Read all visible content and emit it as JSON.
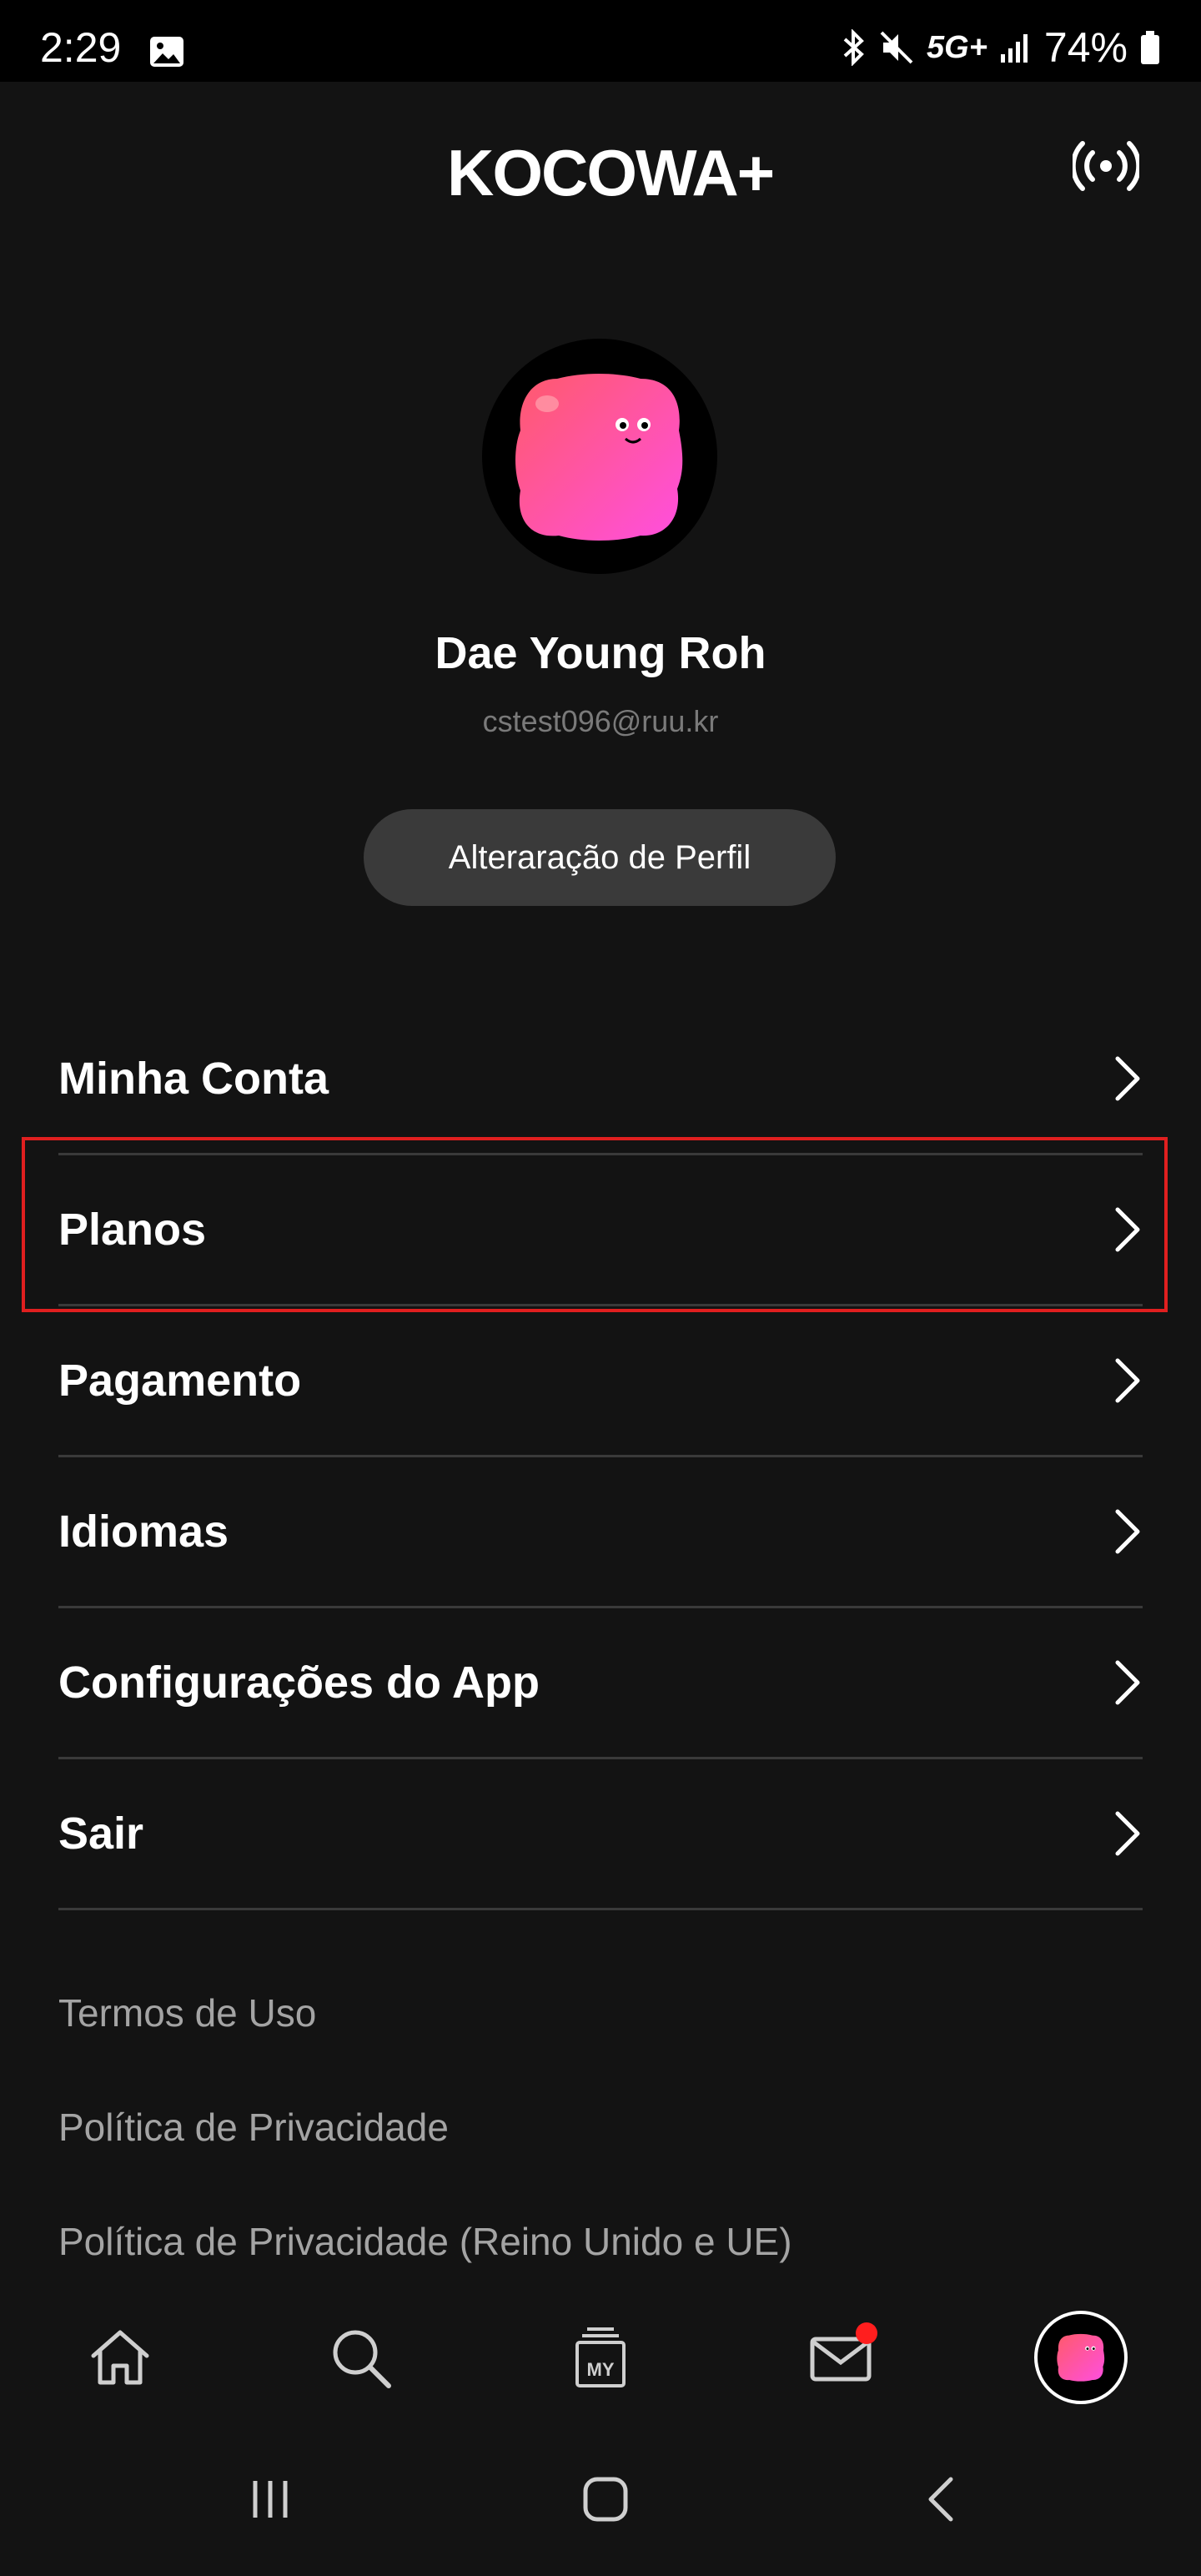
{
  "status_bar": {
    "time": "2:29",
    "network": "5G+",
    "battery": "74%"
  },
  "header": {
    "logo_text": "KOCOWA+",
    "cast_icon": "cast-broadcast-icon"
  },
  "profile": {
    "name": "Dae Young Roh",
    "email": "cstest096@ruu.kr",
    "edit_button_label": "Alteraração de Perfil"
  },
  "menu": {
    "items": [
      {
        "label": "Minha Conta"
      },
      {
        "label": "Planos"
      },
      {
        "label": "Pagamento"
      },
      {
        "label": "Idiomas"
      },
      {
        "label": "Configurações do App"
      },
      {
        "label": "Sair"
      }
    ]
  },
  "links": {
    "items": [
      {
        "label": "Termos de Uso"
      },
      {
        "label": "Política de Privacidade"
      },
      {
        "label": "Política de Privacidade (Reino Unido e UE)"
      }
    ]
  },
  "bottom_nav": {
    "items": [
      {
        "icon": "home-icon"
      },
      {
        "icon": "search-icon"
      },
      {
        "icon": "my-list-icon",
        "text": "MY"
      },
      {
        "icon": "mail-icon"
      },
      {
        "icon": "profile-avatar-icon"
      }
    ]
  },
  "colors": {
    "background": "#131313",
    "highlight": "#e01f1f",
    "notification": "#ff1e1e",
    "avatar_gradient_start": "#ff5a7a",
    "avatar_gradient_end": "#ff4fd8"
  }
}
